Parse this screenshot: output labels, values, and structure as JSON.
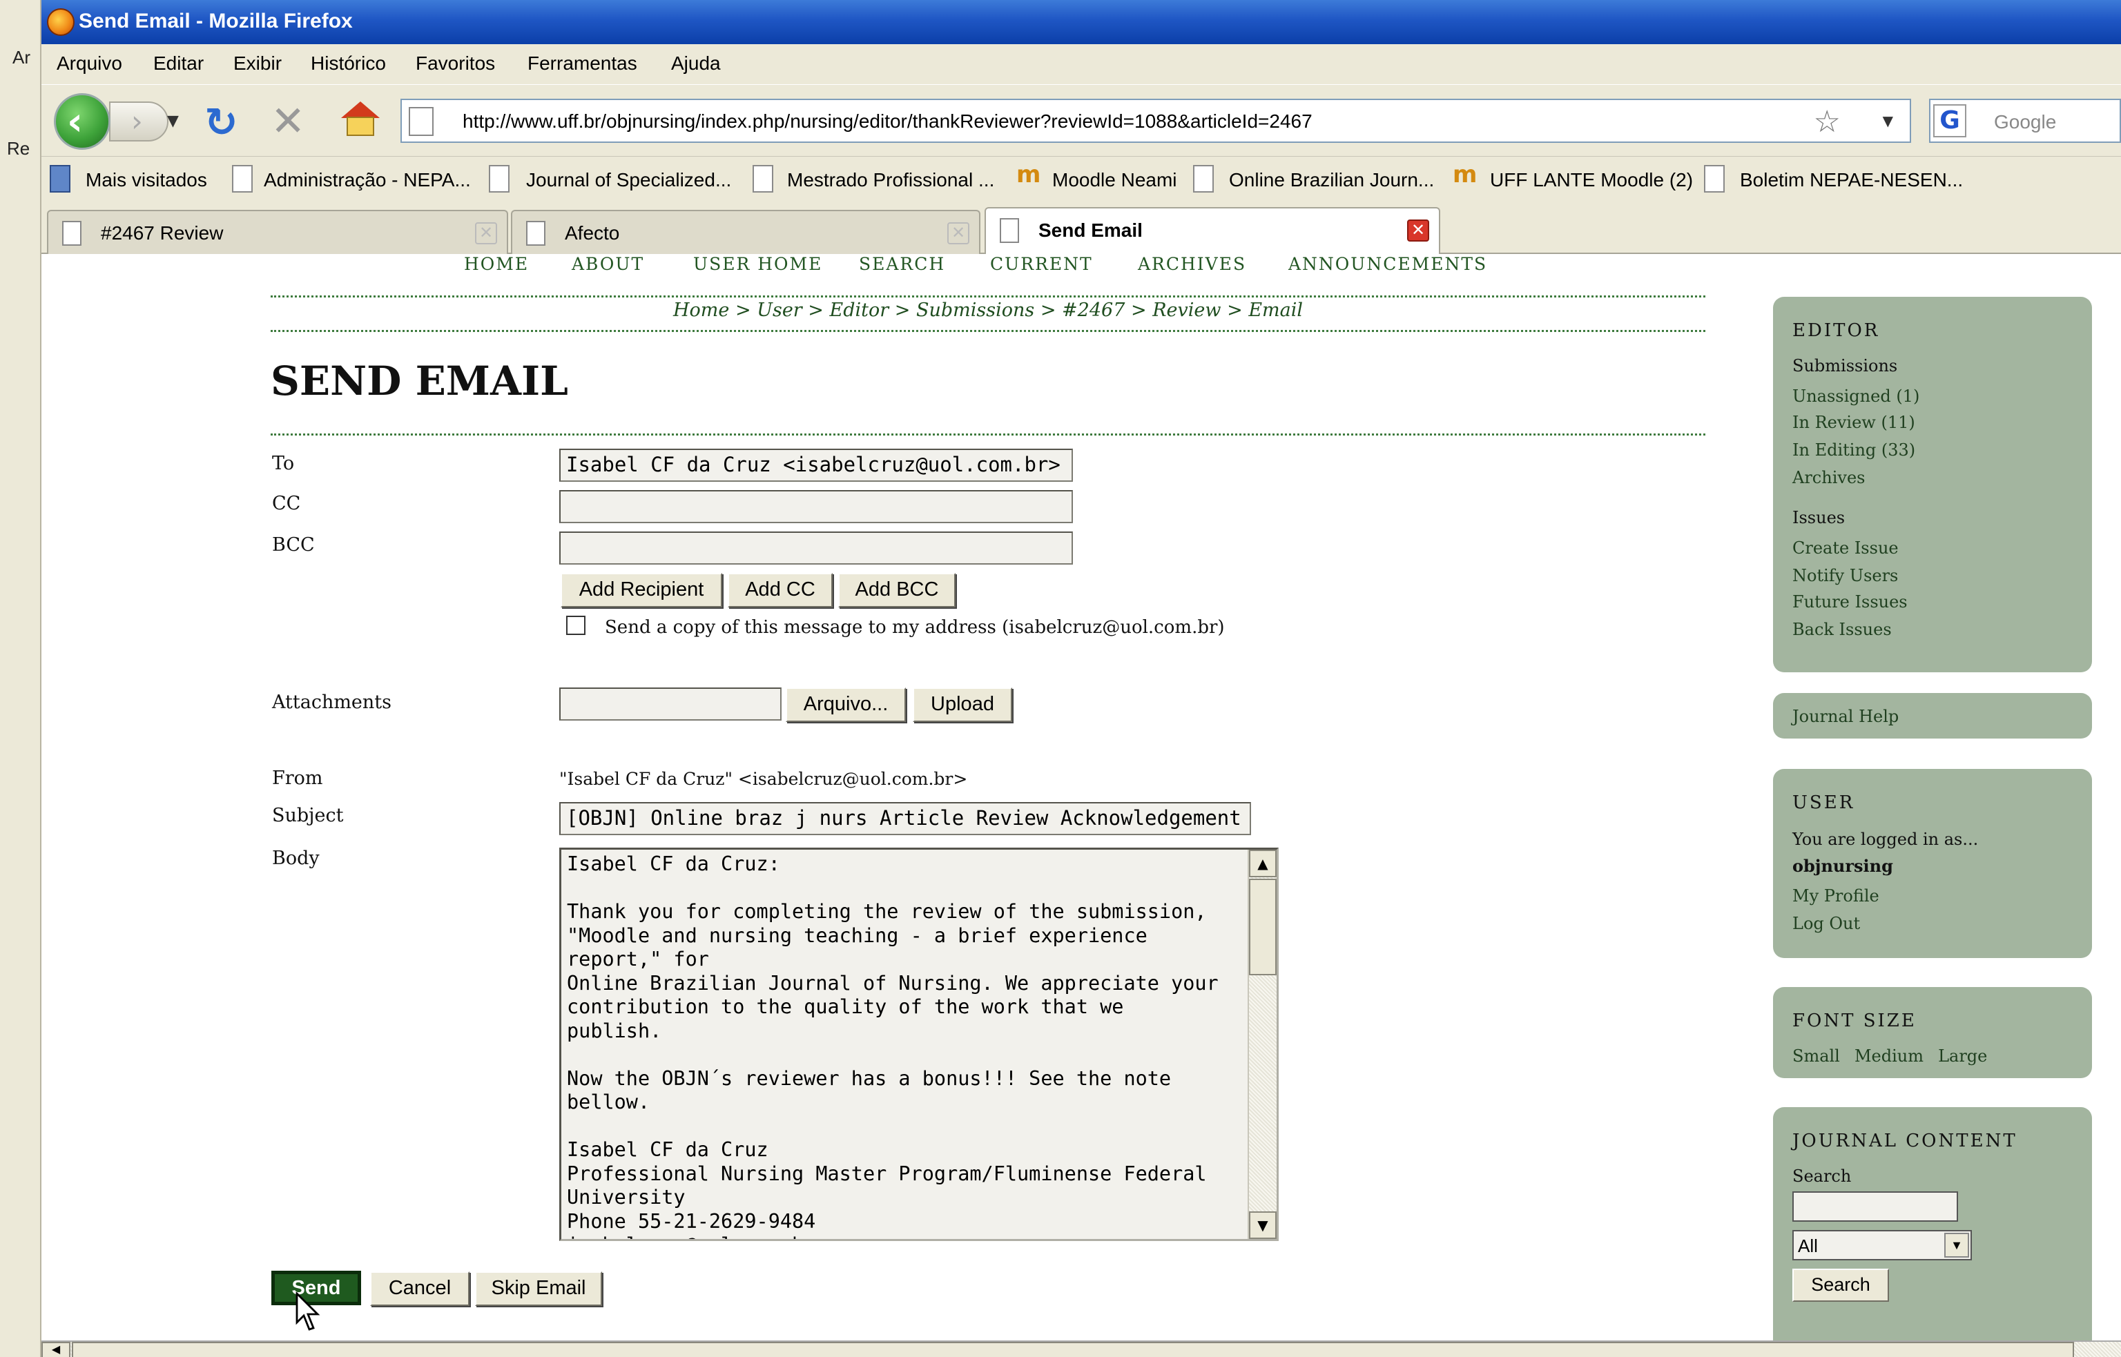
{
  "desktop": {
    "ar_label": "Ar",
    "re_label": "Re"
  },
  "window": {
    "title": "Send Email - Mozilla Firefox"
  },
  "menu": [
    "Arquivo",
    "Editar",
    "Exibir",
    "Histórico",
    "Favoritos",
    "Ferramentas",
    "Ajuda"
  ],
  "nav": {
    "url": "http://www.uff.br/objnursing/index.php/nursing/editor/thankReviewer?reviewId=1088&articleId=2467",
    "search_placeholder": "Google"
  },
  "bookmarks": [
    "Mais visitados",
    "Administração - NEPA...",
    "Journal of Specialized...",
    "Mestrado Profissional ...",
    "Moodle Neami",
    "Online Brazilian Journ...",
    "UFF LANTE Moodle (2)",
    "Boletim NEPAE-NESEN..."
  ],
  "tabs": [
    "#2467 Review",
    "Afecto",
    "Send Email"
  ],
  "site_nav": [
    "HOME",
    "ABOUT",
    "USER HOME",
    "SEARCH",
    "CURRENT",
    "ARCHIVES",
    "ANNOUNCEMENTS"
  ],
  "breadcrumb": [
    "Home",
    "User",
    "Editor",
    "Submissions",
    "#2467",
    "Review",
    "Email"
  ],
  "breadcrumb_sep": ">",
  "page_title": "SEND EMAIL",
  "form": {
    "to_label": "To",
    "to_value": "Isabel CF da Cruz <isabelcruz@uol.com.br>",
    "cc_label": "CC",
    "cc_value": "",
    "bcc_label": "BCC",
    "bcc_value": "",
    "add_recipient": "Add Recipient",
    "add_cc": "Add CC",
    "add_bcc": "Add BCC",
    "copy_label": "Send a copy of this message to my address (isabelcruz@uol.com.br)",
    "attachments_label": "Attachments",
    "browse_button": "Arquivo...",
    "upload_button": "Upload",
    "from_label": "From",
    "from_value": "\"Isabel CF da Cruz\" <isabelcruz@uol.com.br>",
    "subject_label": "Subject",
    "subject_value": "[OBJN] Online braz j nurs Article Review Acknowledgement",
    "body_label": "Body",
    "body_value": "Isabel CF da Cruz:\n\nThank you for completing the review of the submission,\n\"Moodle and nursing teaching - a brief experience report,\" for\nOnline Brazilian Journal of Nursing. We appreciate your\ncontribution to the quality of the work that we publish.\n\nNow the OBJN´s reviewer has a bonus!!! See the note bellow.\n\nIsabel CF da Cruz\nProfessional Nursing Master Program/Fluminense Federal\nUniversity\nPhone 55-21-2629-9484\nisabelcruz@uol.com.br\n\nwww.uff.br/objnursing",
    "send": "Send",
    "cancel": "Cancel",
    "skip": "Skip Email"
  },
  "sidebar": {
    "editor_heading": "EDITOR",
    "submissions_label": "Submissions",
    "unassigned": "Unassigned (1)",
    "in_review": "In Review (11)",
    "in_editing": "In Editing (33)",
    "archives": "Archives",
    "issues_label": "Issues",
    "create_issue": "Create Issue",
    "notify_users": "Notify Users",
    "future_issues": "Future Issues",
    "back_issues": "Back Issues",
    "journal_help": "Journal Help",
    "user_heading": "USER",
    "logged_in_as": "You are logged in as...",
    "username": "objnursing",
    "my_profile": "My Profile",
    "log_out": "Log Out",
    "font_size_heading": "FONT SIZE",
    "font_small": "Small",
    "font_medium": "Medium",
    "font_large": "Large",
    "journal_content_heading": "JOURNAL CONTENT",
    "search_label": "Search",
    "search_scope": "All",
    "search_button": "Search"
  }
}
